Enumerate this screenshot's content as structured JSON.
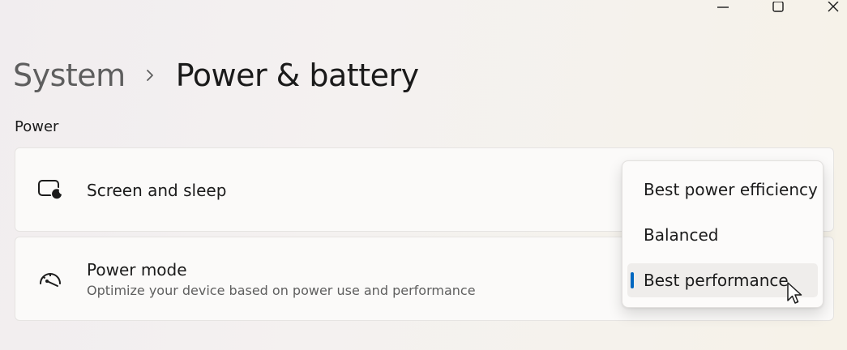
{
  "window": {
    "controls": [
      "minimize-icon",
      "maximize-icon",
      "close-icon"
    ]
  },
  "breadcrumb": {
    "parent": "System",
    "separator_icon": "chevron-right-icon",
    "current": "Power & battery"
  },
  "power_section": {
    "title": "Power",
    "cards": [
      {
        "icon": "screen-sleep-icon",
        "title": "Screen and sleep"
      },
      {
        "icon": "gauge-icon",
        "title": "Power mode",
        "description": "Optimize your device based on power use and performance"
      }
    ]
  },
  "power_mode_dropdown": {
    "options": [
      "Best power efficiency",
      "Balanced",
      "Best performance"
    ],
    "selected": "Best performance",
    "accent": "#0067c0"
  }
}
